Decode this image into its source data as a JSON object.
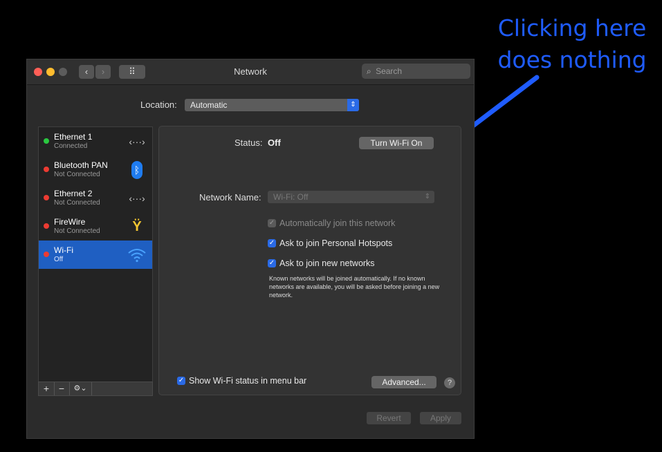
{
  "annotation": {
    "line1": "Clicking here",
    "line2": "does nothing"
  },
  "window": {
    "title": "Network",
    "search_placeholder": "Search",
    "nav": {
      "back": "‹",
      "forward": "›",
      "grid": "⠿"
    }
  },
  "location": {
    "label": "Location:",
    "value": "Automatic"
  },
  "services": [
    {
      "name": "Ethernet 1",
      "status": "Connected",
      "dot_color": "#2ac840",
      "icon": "ethernet-icon",
      "glyph": "‹···›"
    },
    {
      "name": "Bluetooth PAN",
      "status": "Not Connected",
      "dot_color": "#ec3b32",
      "icon": "bluetooth-icon",
      "glyph": "ᛒ"
    },
    {
      "name": "Ethernet 2",
      "status": "Not Connected",
      "dot_color": "#ec3b32",
      "icon": "ethernet-icon",
      "glyph": "‹···›"
    },
    {
      "name": "FireWire",
      "status": "Not Connected",
      "dot_color": "#ec3b32",
      "icon": "firewire-icon",
      "glyph": "Ÿ"
    },
    {
      "name": "Wi-Fi",
      "status": "Off",
      "dot_color": "#ec3b32",
      "icon": "wifi-icon",
      "glyph": "◠"
    }
  ],
  "sidebar_footer": {
    "add": "+",
    "remove": "−",
    "gear": "⚙⌄"
  },
  "detail": {
    "status_label": "Status:",
    "status_value": "Off",
    "turn_on_button": "Turn Wi-Fi On",
    "network_name_label": "Network Name:",
    "network_name_value": "Wi-Fi: Off",
    "auto_join": "Automatically join this network",
    "ask_hotspots": "Ask to join Personal Hotspots",
    "ask_new": "Ask to join new networks",
    "ask_new_note": "Known networks will be joined automatically. If no known networks are available, you will be asked before joining a new network.",
    "show_status": "Show Wi-Fi status in menu bar",
    "advanced_button": "Advanced...",
    "help": "?"
  },
  "footer": {
    "revert": "Revert",
    "apply": "Apply"
  },
  "colors": {
    "accent": "#2a6ae6",
    "annotation": "#1f5cff",
    "selection": "#1f5fc2"
  }
}
